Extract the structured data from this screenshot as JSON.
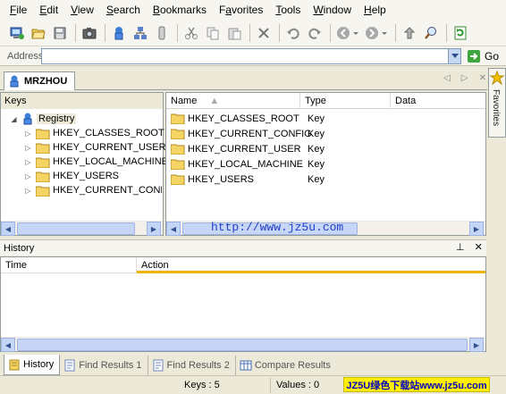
{
  "menu": [
    "File",
    "Edit",
    "View",
    "Search",
    "Bookmarks",
    "Favorites",
    "Tools",
    "Window",
    "Help"
  ],
  "menu_accel": [
    "F",
    "E",
    "V",
    "S",
    "B",
    "a",
    "T",
    "W",
    "H"
  ],
  "address": {
    "label": "Address",
    "value": "",
    "go_label": "Go"
  },
  "document_tab": {
    "title": "MRZHOU"
  },
  "favorites_sidebar": {
    "label": "Favorites"
  },
  "keys_pane": {
    "title": "Keys",
    "root": "Registry",
    "items": [
      "HKEY_CLASSES_ROOT",
      "HKEY_CURRENT_USER",
      "HKEY_LOCAL_MACHINE",
      "HKEY_USERS",
      "HKEY_CURRENT_CONFIG"
    ]
  },
  "values_pane": {
    "columns": [
      "Name",
      "Type",
      "Data"
    ],
    "rows": [
      {
        "name": "HKEY_CLASSES_ROOT",
        "type": "Key",
        "data": ""
      },
      {
        "name": "HKEY_CURRENT_CONFIG",
        "type": "Key",
        "data": ""
      },
      {
        "name": "HKEY_CURRENT_USER",
        "type": "Key",
        "data": ""
      },
      {
        "name": "HKEY_LOCAL_MACHINE",
        "type": "Key",
        "data": ""
      },
      {
        "name": "HKEY_USERS",
        "type": "Key",
        "data": ""
      }
    ]
  },
  "watermark": "http://www.jz5u.com",
  "history": {
    "title": "History",
    "columns": [
      "Time",
      "Action"
    ]
  },
  "bottom_tabs": [
    "History",
    "Find Results 1",
    "Find Results 2",
    "Compare Results"
  ],
  "status": {
    "keys": "Keys : 5",
    "values": "Values : 0"
  },
  "brand": "JZ5U绿色下载站www.jz5u.com",
  "colors": {
    "folder": "#f5d463",
    "accent": "#f0b400",
    "selection": "#316ac5"
  }
}
